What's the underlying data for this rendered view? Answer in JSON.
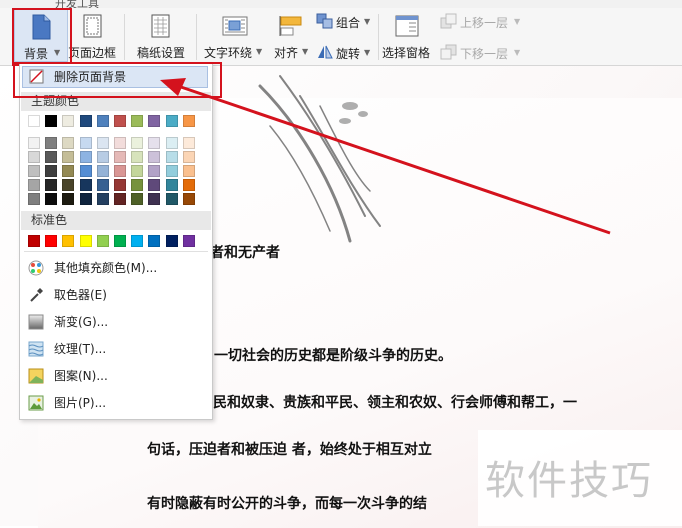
{
  "tabstrip": {
    "tab_label": "开发工具"
  },
  "ribbon": {
    "background_label": "背景",
    "page_border_label": "页面边框",
    "paper_settings_label": "稿纸设置",
    "text_wrap_label": "文字环绕",
    "align_label": "对齐",
    "group_label": "组合",
    "rotate_label": "旋转",
    "selection_pane_label": "选择窗格",
    "bring_forward_label": "上移一层",
    "send_backward_label": "下移一层"
  },
  "menu": {
    "remove_bg_label": "删除页面背景",
    "theme_colors_header": "主题颜色",
    "standard_colors_header": "标准色",
    "items": [
      {
        "label": "其他填充颜色(M)...",
        "icon": "palette-icon"
      },
      {
        "label": "取色器(E)",
        "icon": "eyedropper-icon"
      },
      {
        "label": "渐变(G)...",
        "icon": "gradient-icon"
      },
      {
        "label": "纹理(T)...",
        "icon": "texture-icon"
      },
      {
        "label": "图案(N)...",
        "icon": "pattern-icon"
      },
      {
        "label": "图片(P)...",
        "icon": "picture-icon"
      }
    ],
    "theme_top_row": [
      "#ffffff",
      "#000000",
      "#eeece1",
      "#1f497d",
      "#4f81bd",
      "#c0504d",
      "#9bbb59",
      "#8064a2",
      "#4bacc6",
      "#f79646"
    ],
    "theme_shades": [
      [
        "#f2f2f2",
        "#7f7f7f",
        "#ddd9c3",
        "#c6d9f0",
        "#dbe5f1",
        "#f2dcdb",
        "#ebf1dd",
        "#e5e0ec",
        "#dbeef3",
        "#fdeada"
      ],
      [
        "#d8d8d8",
        "#595959",
        "#c4bd97",
        "#8db3e2",
        "#b8cce4",
        "#e5b9b7",
        "#d7e3bc",
        "#ccc1d9",
        "#b7dde8",
        "#fbd5b5"
      ],
      [
        "#bfbfbf",
        "#3f3f3f",
        "#938953",
        "#548dd4",
        "#95b3d7",
        "#d99694",
        "#c3d69b",
        "#b2a2c7",
        "#92cddc",
        "#fac08f"
      ],
      [
        "#a5a5a5",
        "#262626",
        "#494429",
        "#17365d",
        "#366092",
        "#953734",
        "#76923c",
        "#5f497a",
        "#31859b",
        "#e36c09"
      ],
      [
        "#7f7f7f",
        "#0c0c0c",
        "#1d1b10",
        "#0f243e",
        "#244061",
        "#632423",
        "#4f6128",
        "#3f3151",
        "#205867",
        "#974806"
      ]
    ],
    "standard_colors": [
      "#c00000",
      "#ff0000",
      "#ffc000",
      "#ffff00",
      "#92d050",
      "#00b050",
      "#00b0f0",
      "#0070c0",
      "#002060",
      "#7030a0"
    ]
  },
  "document": {
    "lines": [
      "者和无产者",
      "一切社会的历史都是阶级斗争的历史。",
      "民和奴隶、贵族和平民、领主和农奴、行会师傅和帮工，一",
      "句话，压迫者和被压迫  者，始终处于相互对立",
      "有时隐蔽有时公开的斗争，而每一次斗争的结"
    ]
  },
  "watermark": {
    "text": "软件技巧"
  },
  "colors": {
    "annotation_red": "#d4121d",
    "ribbon_bg": "#f6f6f6"
  }
}
